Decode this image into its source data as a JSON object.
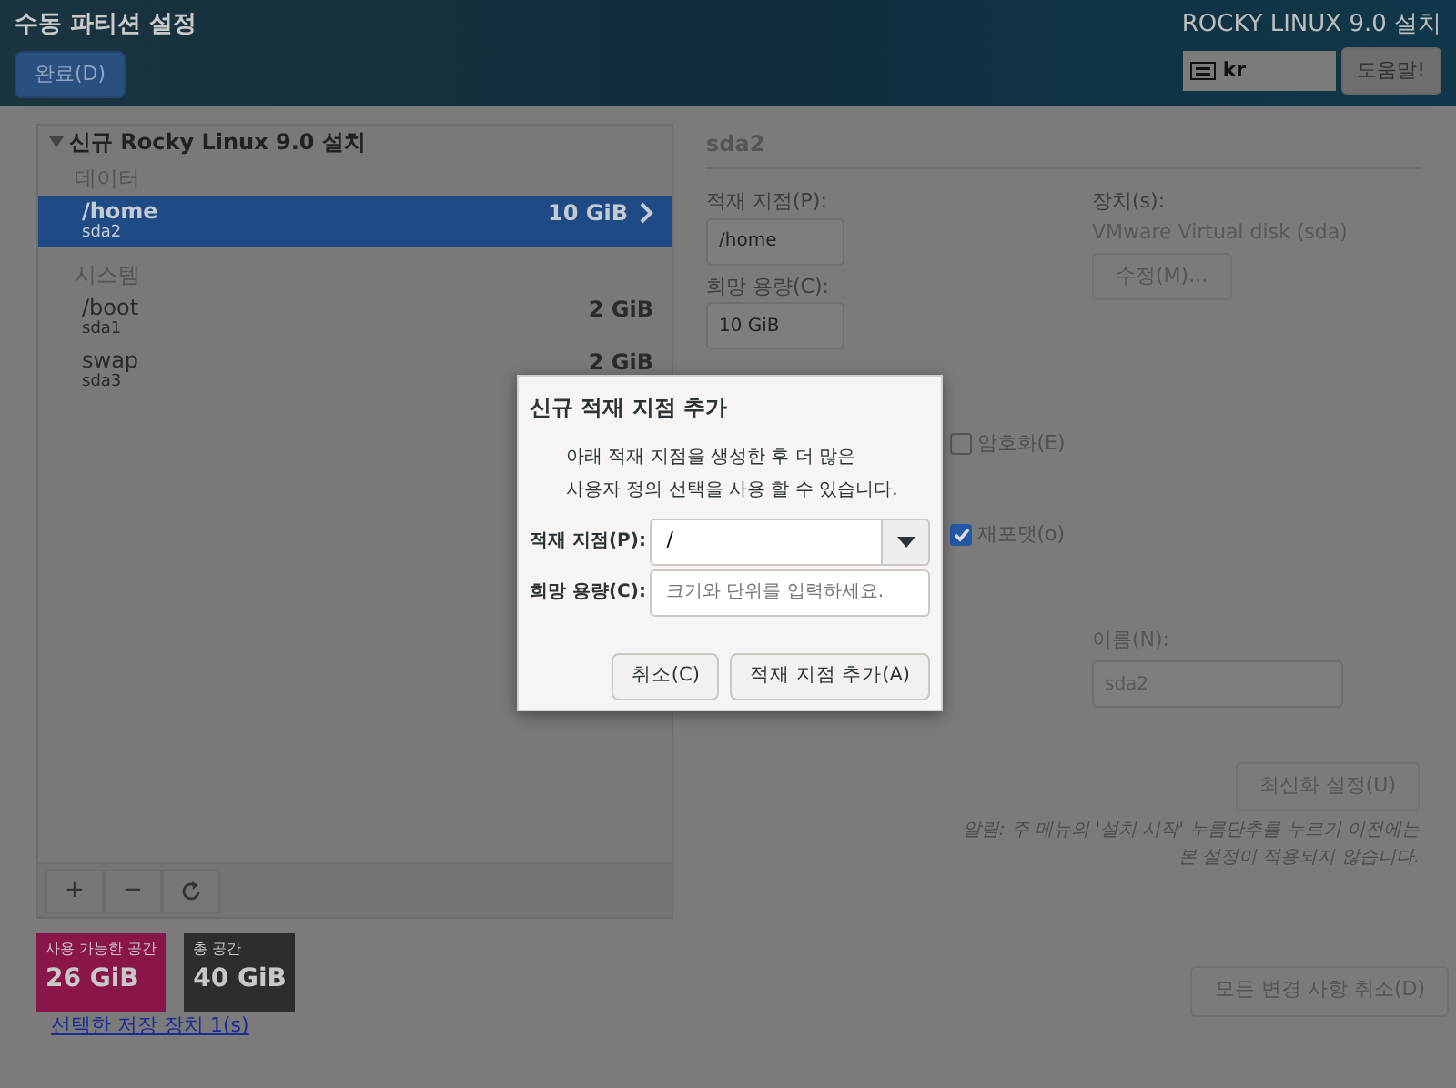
{
  "header": {
    "title": "수동 파티션 설정",
    "done_button": "완료(D)",
    "product": "ROCKY LINUX 9.0 설치",
    "keyboard_layout": "kr",
    "help_button": "도움말!"
  },
  "partitions": {
    "root": {
      "label": "신규 Rocky Linux 9.0 설치",
      "expanded": true
    },
    "groups": [
      {
        "label": "데이터",
        "items": [
          {
            "mount": "/home",
            "device": "sda2",
            "size": "10 GiB",
            "selected": true
          }
        ]
      },
      {
        "label": "시스템",
        "items": [
          {
            "mount": "/boot",
            "device": "sda1",
            "size": "2 GiB",
            "selected": false
          },
          {
            "mount": "swap",
            "device": "sda3",
            "size": "2 GiB",
            "selected": false
          }
        ]
      }
    ],
    "toolbar": [
      {
        "kind": "add",
        "label": "+"
      },
      {
        "kind": "remove",
        "label": "−"
      },
      {
        "kind": "refresh"
      }
    ]
  },
  "storage": [
    {
      "label": "사용 가능한 공간",
      "value": "26 GiB",
      "color": "#8a1548"
    },
    {
      "label": "총 공간",
      "value": "40 GiB",
      "color": "#2d2d2d"
    }
  ],
  "storage_link": "선택한 저장 장치 1(s)",
  "details": {
    "title": "sda2",
    "mount_label": "적재 지점(P):",
    "mount_value": "/home",
    "capacity_label": "희망 용량(C):",
    "capacity_value": "10 GiB",
    "device_label": "장치(s):",
    "device_value": "VMware Virtual disk (sda)",
    "modify_button": "수정(M)...",
    "options": [
      {
        "label": "암호화(E)",
        "checked": false
      },
      {
        "label": "재포맷(o)",
        "checked": true
      }
    ],
    "name_label": "이름(N):",
    "name_value": "sda2",
    "update_button": "최신화 설정(U)",
    "note": [
      "알림: 주 메뉴의 '설치 시작' 누름단추를 누르기 이전에는",
      "본 설정이 적용되지 않습니다."
    ],
    "reset_button": "모든 변경 사항 취소(D)"
  },
  "dialog": {
    "title": "신규 적재 지점 추가",
    "description": [
      "아래 적재 지점을 생성한 후 더 많은",
      "사용자 정의 선택을 사용 할 수 있습니다."
    ],
    "mount_label": "적재 지점(P):",
    "mount_value": "/",
    "capacity_label": "희망 용량(C):",
    "capacity_placeholder": "크기와 단위를 입력하세요.",
    "cancel_button": "취소(C)",
    "add_button": "적재 지점 추가(A)"
  }
}
